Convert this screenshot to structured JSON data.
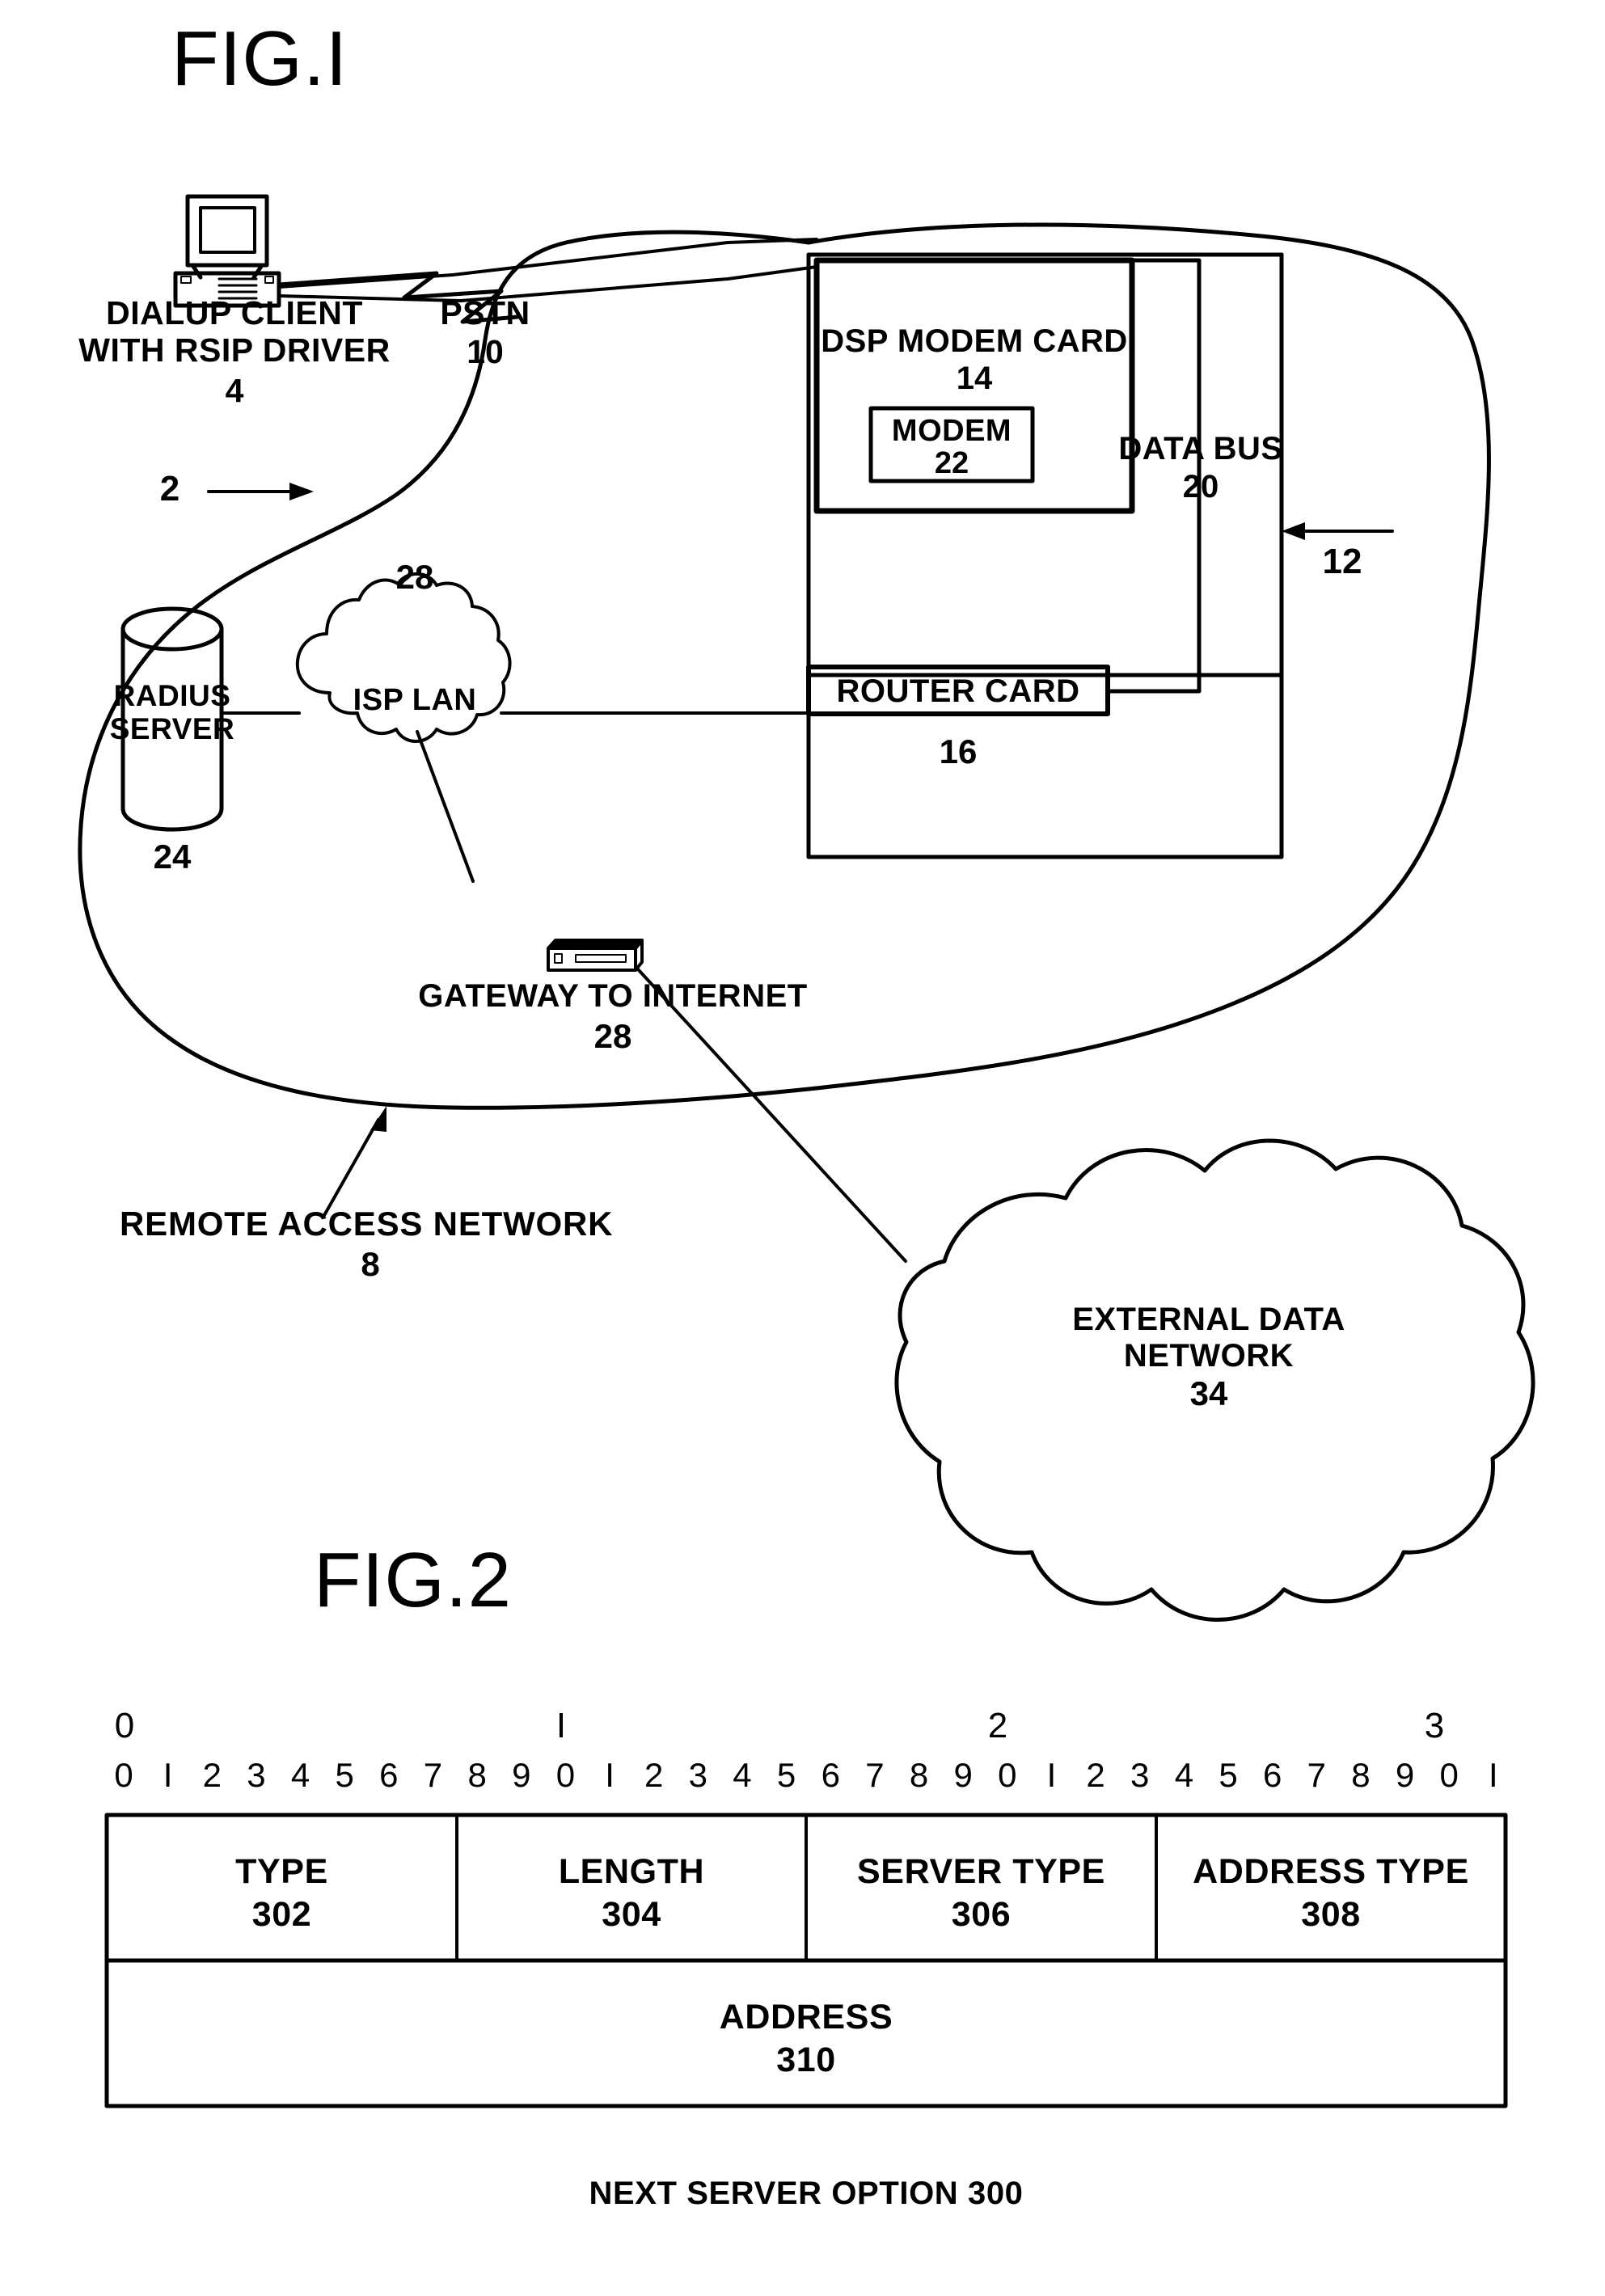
{
  "figures": [
    {
      "id": "fig1",
      "title": "FIG.I",
      "caption": "REMOTE ACCESS NETWORK",
      "caption_number": "8",
      "nodes": {
        "client": {
          "label": "DIALUP CLIENT\nWITH RSIP DRIVER",
          "number": "4",
          "icon": "desktop-computer-icon"
        },
        "pstn": {
          "label": "PSTN",
          "number": "10",
          "icon": "lightning-bolt-icon"
        },
        "system_ref": {
          "number": "2"
        },
        "nas_ref": {
          "number": "12"
        },
        "dsp_modem_card": {
          "label": "DSP MODEM CARD",
          "number": "14"
        },
        "modem": {
          "label": "MODEM",
          "number": "22"
        },
        "data_bus": {
          "label": "DATA BUS",
          "number": "20"
        },
        "router_card": {
          "label": "ROUTER CARD",
          "number": "16"
        },
        "radius_server": {
          "label": "RADIUS\nSERVER",
          "number": "24",
          "icon": "database-cylinder-icon"
        },
        "isp_lan": {
          "label": "ISP LAN",
          "number": "28",
          "icon": "cloud-icon"
        },
        "gateway": {
          "label": "GATEWAY TO INTERNET",
          "number": "28",
          "icon": "router-appliance-icon"
        },
        "external_network": {
          "label": "EXTERNAL DATA\nNETWORK",
          "number": "34",
          "icon": "cloud-icon"
        }
      }
    },
    {
      "id": "fig2",
      "title": "FIG.2",
      "caption": "NEXT SERVER OPTION 300",
      "bit_decades": [
        "0",
        "I",
        "2",
        "3"
      ],
      "bit_digits": [
        "0",
        "I",
        "2",
        "3",
        "4",
        "5",
        "6",
        "7",
        "8",
        "9",
        "0",
        "I",
        "2",
        "3",
        "4",
        "5",
        "6",
        "7",
        "8",
        "9",
        "0",
        "I",
        "2",
        "3",
        "4",
        "5",
        "6",
        "7",
        "8",
        "9",
        "0",
        "I"
      ],
      "rows": [
        {
          "cells": [
            {
              "label": "TYPE",
              "number": "302",
              "width_bits": 8
            },
            {
              "label": "LENGTH",
              "number": "304",
              "width_bits": 8
            },
            {
              "label": "SERVER TYPE",
              "number": "306",
              "width_bits": 8
            },
            {
              "label": "ADDRESS TYPE",
              "number": "308",
              "width_bits": 8
            }
          ]
        },
        {
          "cells": [
            {
              "label": "ADDRESS",
              "number": "310",
              "width_bits": 32
            }
          ]
        }
      ]
    }
  ],
  "colors": {
    "ink": "#000000",
    "paper": "#ffffff"
  }
}
